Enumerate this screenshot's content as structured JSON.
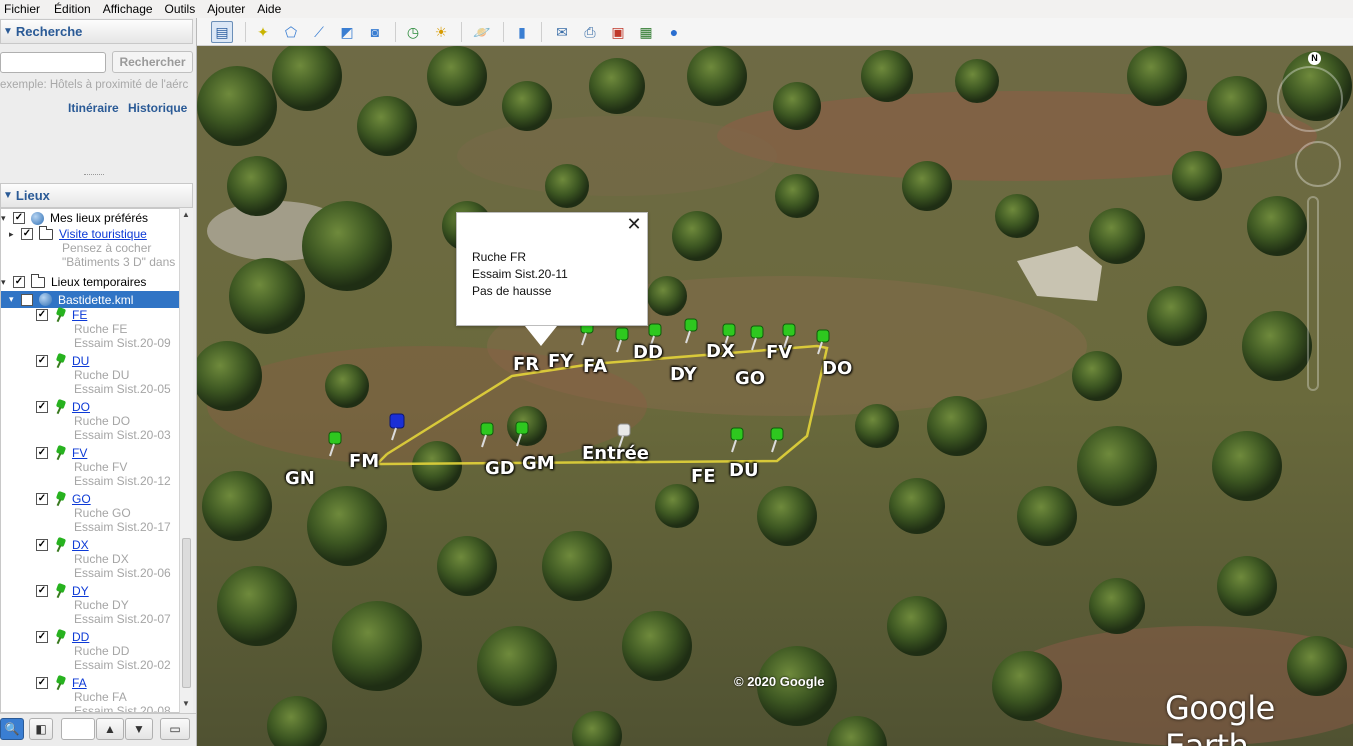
{
  "menu": [
    "Fichier",
    "Édition",
    "Affichage",
    "Outils",
    "Ajouter",
    "Aide"
  ],
  "search": {
    "header": "Recherche",
    "button": "Rechercher",
    "hint": "exemple: Hôtels à proximité de l'aérc",
    "link_itinerary": "Itinéraire",
    "link_history": "Historique"
  },
  "places": {
    "header": "Lieux",
    "my_places": "Mes lieux préférés",
    "tour": "Visite touristique",
    "tour_hint1": "Pensez à cocher",
    "tour_hint2": "\"Bâtiments 3 D\" dans",
    "temp": "Lieux temporaires",
    "kml": "Bastidette.kml",
    "items": [
      {
        "name": "FE",
        "line1": "Ruche FE",
        "line2": "Essaim Sist.20-09"
      },
      {
        "name": "DU",
        "line1": "Ruche DU",
        "line2": "Essaim Sist.20-05"
      },
      {
        "name": "DO",
        "line1": "Ruche DO",
        "line2": "Essaim Sist.20-03"
      },
      {
        "name": "FV",
        "line1": "Ruche FV",
        "line2": "Essaim Sist.20-12"
      },
      {
        "name": "GO",
        "line1": "Ruche GO",
        "line2": "Essaim Sist.20-17"
      },
      {
        "name": "DX",
        "line1": "Ruche DX",
        "line2": "Essaim Sist.20-06"
      },
      {
        "name": "DY",
        "line1": "Ruche DY",
        "line2": "Essaim Sist.20-07"
      },
      {
        "name": "DD",
        "line1": "Ruche DD",
        "line2": "Essaim Sist.20-02"
      },
      {
        "name": "FA",
        "line1": "Ruche FA",
        "line2": "Essaim Sist.20-08"
      }
    ]
  },
  "balloon": {
    "line1": "Ruche FR",
    "line2": "Essaim Sist.20-11",
    "line3": "Pas de hausse"
  },
  "map": {
    "labels": [
      "FR",
      "FY",
      "FA",
      "DD",
      "DY",
      "DX",
      "GO",
      "FV",
      "DO",
      "GN",
      "FM",
      "GD",
      "GM",
      "Entrée",
      "FE",
      "DU"
    ],
    "copyright": "© 2020 Google",
    "logo": "Google Earth",
    "compass": "N"
  }
}
